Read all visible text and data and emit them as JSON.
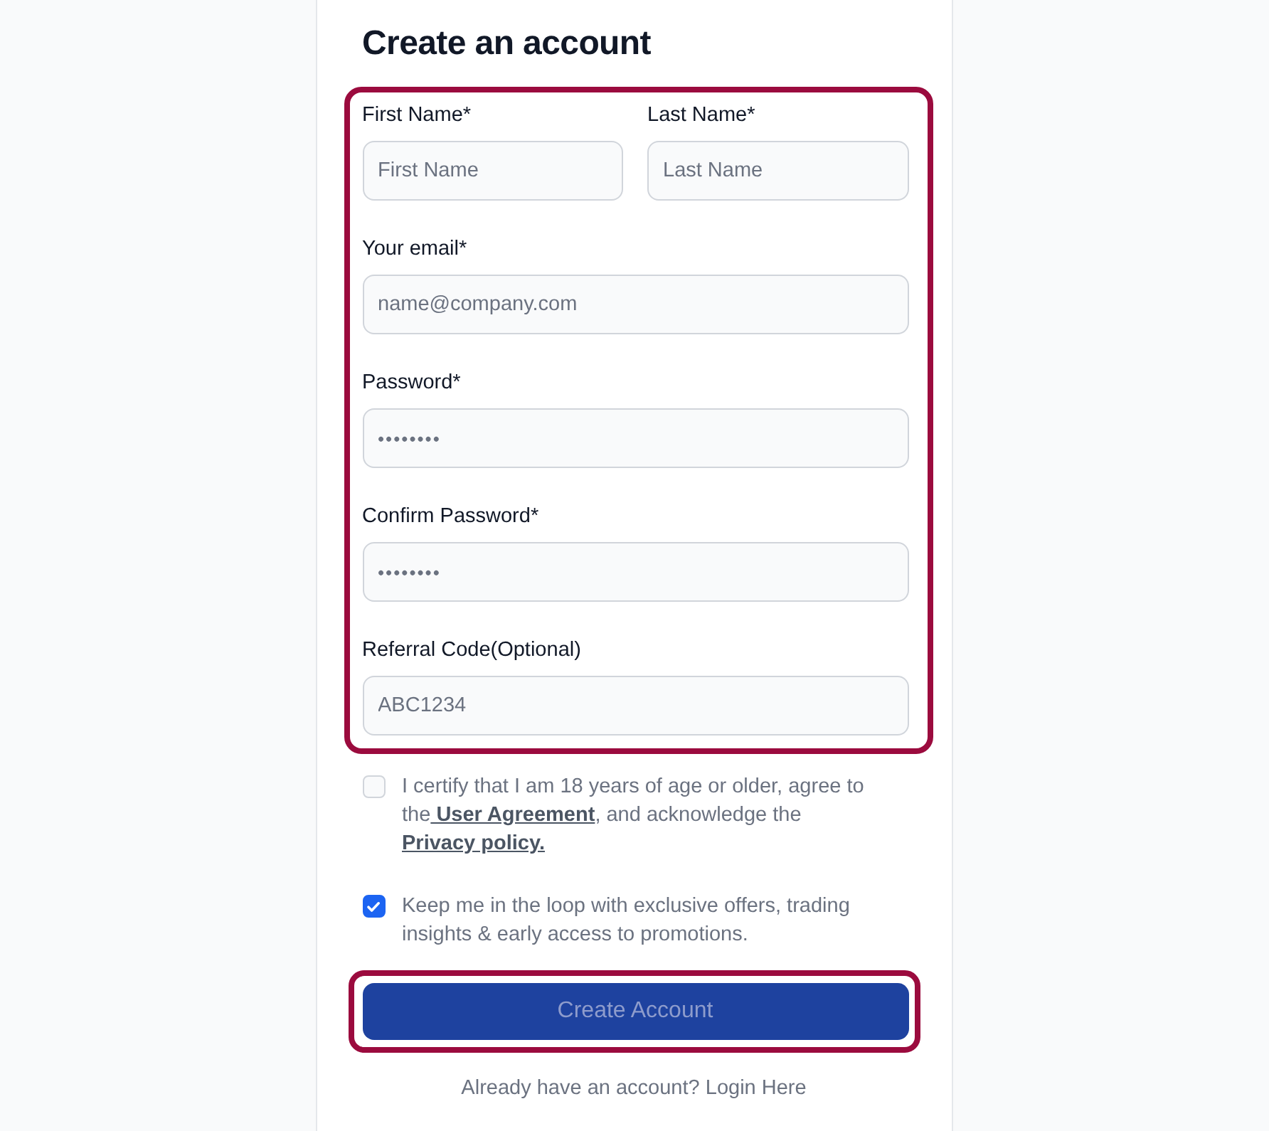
{
  "heading": "Create an account",
  "form": {
    "name_row": [
      {
        "label": "First Name*",
        "placeholder": "First Name"
      },
      {
        "label": "Last Name*",
        "placeholder": "Last Name"
      }
    ],
    "fields": [
      {
        "label": "Your email*",
        "placeholder": "name@company.com"
      },
      {
        "label": "Password*",
        "value": "••••••••"
      },
      {
        "label": "Confirm Password*",
        "value": "••••••••"
      },
      {
        "label": "Referral Code(Optional)",
        "placeholder": "ABC1234"
      }
    ]
  },
  "consents": [
    {
      "checked": false,
      "parts": [
        {
          "text": "I certify that I am 18 years of age or older, agree to the"
        },
        {
          "text": " User Agreement",
          "kind": "link"
        },
        {
          "text": ", and acknowledge the "
        },
        {
          "text": "Privacy policy.",
          "kind": "link"
        }
      ]
    },
    {
      "checked": true,
      "parts": [
        {
          "text": "Keep me in the loop with exclusive offers, trading insights & early access to promotions."
        }
      ]
    }
  ],
  "submit": {
    "label": "Create Account",
    "disabled": true
  },
  "footer": {
    "text": "Already have an account?",
    "link": "Login Here"
  }
}
